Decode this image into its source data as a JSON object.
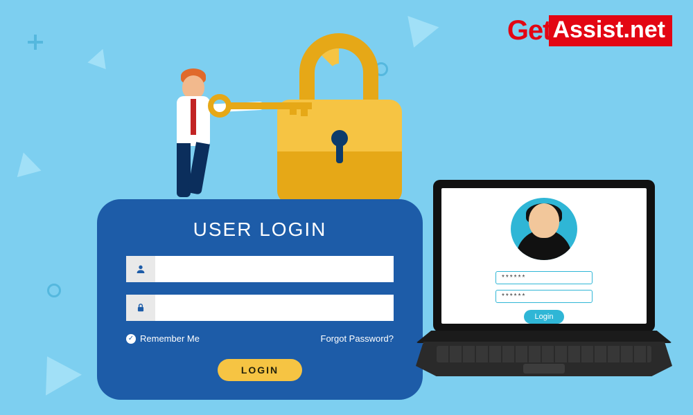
{
  "logo": {
    "part1": "Get",
    "part2": "Assist.net"
  },
  "card": {
    "title": "USER LOGIN",
    "username_value": "",
    "password_value": "",
    "remember_label": "Remember Me",
    "forgot_label": "Forgot Password?",
    "login_label": "LOGIN"
  },
  "laptop": {
    "field1_value": "******",
    "field2_value": "******",
    "login_label": "Login"
  }
}
